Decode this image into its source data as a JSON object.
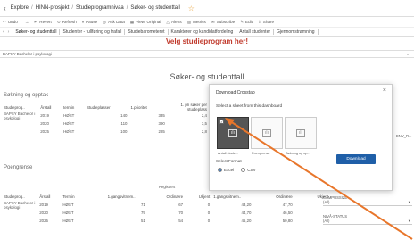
{
  "topbar": {
    "crumbs": [
      "Explore",
      "/",
      "HINN-prosjekt",
      "/",
      "Studieprogramnivaa",
      "/",
      "Søker- og studenttall"
    ]
  },
  "toolbar": {
    "items": [
      {
        "icon": "undo-icon",
        "label": "Undo"
      },
      {
        "icon": "redo-icon",
        "label": "→"
      },
      {
        "icon": "revert-icon",
        "label": "Revert"
      },
      {
        "icon": "refresh-icon",
        "label": "Refresh"
      },
      {
        "icon": "pause-icon",
        "label": "Pause"
      },
      {
        "icon": "alerts-icon",
        "label": "Alerts"
      },
      {
        "icon": "metrics-icon",
        "label": "Metrics"
      },
      {
        "icon": "subscribe-icon",
        "label": "Subscribe"
      },
      {
        "icon": "edit-icon",
        "label": "Edit"
      },
      {
        "icon": "share-icon",
        "label": "Share"
      }
    ],
    "data_label": "Ask Data",
    "view_label": "View: Original"
  },
  "tabs": {
    "items": [
      "Søker- og studenttall",
      "Studenter - fullføring og frafall",
      "Studiebarometeret",
      "Karakterer og kandidatfordeling",
      "Antall studenter",
      "Gjennomstrømning"
    ]
  },
  "main": {
    "velg_heading": "Velg studieprogram her!",
    "filter_value": "BAPSY Bachelor i psykologi",
    "title": "Søker- og studenttall",
    "section1": "Søkning og opptak",
    "section2": "Poengrense"
  },
  "table1": {
    "headers": [
      "Studieprog..",
      "Årstall",
      "termin",
      "Studieplasser",
      "1.prioritet",
      "1. pri søker per studieplass"
    ],
    "program": "BAPSY Bachelor i psykologi",
    "rows": [
      {
        "year": "2019",
        "term": "HØST",
        "plasser": "140",
        "prio": "335",
        "ratio": "2,4"
      },
      {
        "year": "2020",
        "term": "HØST",
        "plasser": "110",
        "prio": "390",
        "ratio": "3,5"
      },
      {
        "year": "2025",
        "term": "HØST",
        "plasser": "100",
        "prio": "285",
        "ratio": "2,8"
      }
    ]
  },
  "table2": {
    "group": "Registrert",
    "headers": [
      "Studieprog..",
      "Årstall",
      "Termin",
      "1.gangsvitnem..",
      "Ordinære",
      "Ukjent",
      "1.gangsvitnem..",
      "Ordinære",
      "Ukjent"
    ],
    "program": "BAPSY Bachelor i psykologi",
    "rows": [
      {
        "year": "2019",
        "term": "HØST",
        "a": "71",
        "b": "67",
        "c": "0",
        "d": "43,20",
        "e": "47,70"
      },
      {
        "year": "2020",
        "term": "HØST",
        "a": "79",
        "b": "70",
        "c": "0",
        "d": "44,70",
        "e": "46,50"
      },
      {
        "year": "2025",
        "term": "HØST",
        "a": "51",
        "b": "54",
        "c": "0",
        "d": "46,20",
        "e": "50,80"
      }
    ]
  },
  "right_fields": {
    "f1_label": "ENV_R...",
    "f2_label": "CAMPUSSIZE",
    "f2_value": "(All)",
    "f3_label": "NIVÅ-STATUS",
    "f3_value": "(All)"
  },
  "modal": {
    "title": "Download Crosstab",
    "subtitle": "Select a sheet from this dashboard",
    "sheets": [
      "Antall studer..",
      "Poengrense",
      "Søkning og op.."
    ],
    "format_label": "Select Format",
    "formats": [
      "Excel",
      "CSV"
    ],
    "download": "Download"
  }
}
